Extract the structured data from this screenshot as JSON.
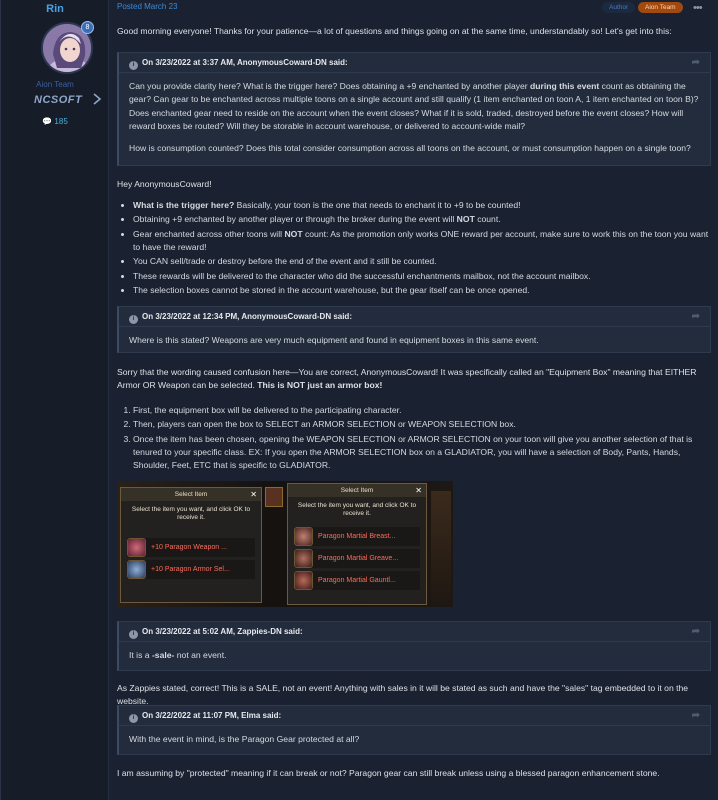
{
  "author": {
    "name": "Rin",
    "role": "Aion Team",
    "company": "NCSOFT",
    "reputation": "185",
    "avatar_badge": "8"
  },
  "post": {
    "posted": "Posted March 23",
    "badge_author": "Author",
    "badge_team": "Aion Team",
    "more": "•••"
  },
  "para1": "Good morning everyone! Thanks for your patience—a lot of questions and things going on at the same time, understandably so! Let's get into this:",
  "quote1": {
    "header": "On 3/23/2022 at 3:37 AM, AnonymousCoward-DN said:",
    "p1_a": "Can you provide clarity here?  What is the trigger here?  Does obtaining a +9 enchanted by another player ",
    "p1_b": "during this event",
    "p1_c": " count as obtaining the gear?  Can gear to be enchanted across multiple toons on a single account and still qualify (1 item enchanted on toon A, 1 item enchanted on toon B)?  Does enchanted gear need to reside on the account when the event closes?  What if it is sold, traded, destroyed before the event closes?  How will reward boxes be routed?  Will they be storable in account warehouse, or delivered to account-wide mail?",
    "p2": "How is consumption counted?  Does this total consider consumption across all toons on the account, or must consumption happen on a single toon?"
  },
  "hey": "Hey AnonymousCoward!",
  "bullets": {
    "b1_a": "What is the trigger here?",
    "b1_b": " Basically, your toon is the one that needs to enchant it to +9 to be counted!",
    "b2_a": "Obtaining +9 enchanted by another player or through the broker during the event will ",
    "b2_b": "NOT",
    "b2_c": " count.",
    "b3_a": "Gear enchanted across other toons will ",
    "b3_b": "NOT",
    "b3_c": " count: As the promotion only works ONE reward per account, make sure to work this on the toon you want to have the reward!",
    "b4": "You CAN sell/trade or destroy before the end of the event and it still be counted.",
    "b5": "These rewards will be delivered to the character who did the successful enchantments mailbox, not the account mailbox.",
    "b6": "The selection boxes cannot be stored in the account warehouse, but the gear itself can be once opened."
  },
  "quote2": {
    "header": "On 3/23/2022 at 12:34 PM, AnonymousCoward-DN said:",
    "body": "Where is this stated?  Weapons are very much equipment and found in equipment boxes in this same event."
  },
  "para2_a": "Sorry that the wording caused confusion here—You are correct, AnonymousCoward! It was specifically called an \"Equipment Box\" meaning that EITHER Armor OR Weapon can be selected. ",
  "para2_b": "This is NOT just an armor box!",
  "steps": {
    "s1": "First, the equipment box will be delivered to the participating character.",
    "s2": "Then, players can open the box to SELECT an ARMOR SELECTION or WEAPON SELECTION box.",
    "s3": "Once the item has been chosen, opening the WEAPON SELECTION or ARMOR SELECTION on your toon will give you another selection of that is tenured to your specific class. EX: If you open the ARMOR SELECTION box on a GLADIATOR, you will have a selection of Body, Pants, Hands, Shoulder, Feet, ETC that is specific to GLADIATOR."
  },
  "game_image": {
    "left_title": "Select Item",
    "left_instruction": "Select the item you want, and click OK to receive it.",
    "left_items": [
      "+10 Paragon Weapon ...",
      "+10 Paragon Armor Sel..."
    ],
    "right_title": "Select Item",
    "right_instruction": "Select the item you want, and click OK to receive it.",
    "right_items": [
      "Paragon Martial Breast...",
      "Paragon Martial Greave...",
      "Paragon Martial Gauntl..."
    ],
    "close": "✕"
  },
  "quote3": {
    "header": "On 3/23/2022 at 5:02 AM, Zappies-DN said:",
    "body_a": "It is a ",
    "body_b": "-sale-",
    "body_c": " not an event."
  },
  "para3": "As Zappies stated, correct! This is a SALE, not an event! Anything with sales in it will be stated as such and have the \"sales\" tag embedded to it on the website.",
  "quote4": {
    "header": "On 3/22/2022 at 11:07 PM, Elma said:",
    "body": "With the event in mind, is the Paragon Gear protected at all?"
  },
  "para4": "I am assuming by \"protected\" meaning if it can break or not? Paragon gear can still break unless using a blessed paragon enhancement stone."
}
